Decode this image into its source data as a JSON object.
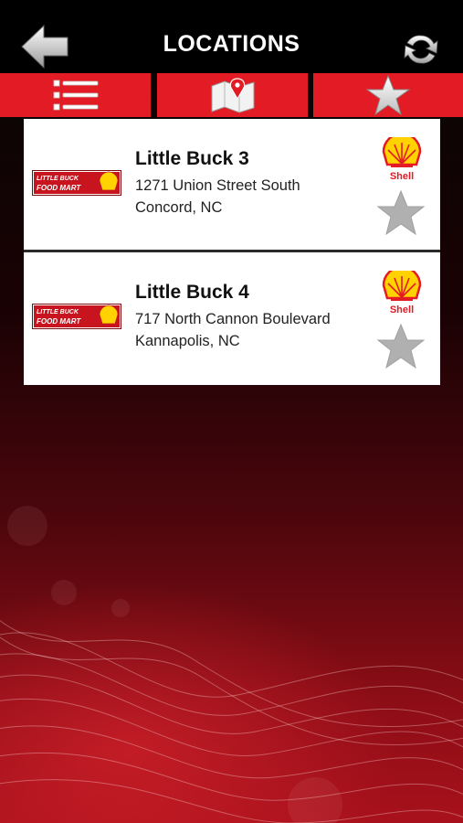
{
  "header": {
    "title": "LOCATIONS",
    "back_icon": "back-arrow-icon",
    "refresh_icon": "refresh-icon"
  },
  "tabs": [
    {
      "icon": "list-icon"
    },
    {
      "icon": "map-icon"
    },
    {
      "icon": "star-icon"
    }
  ],
  "colors": {
    "accent_red": "#e21b24",
    "header_bg": "#000000",
    "card_bg": "#ffffff",
    "star_gray": "#b0b0b0",
    "shell_yellow": "#ffd200"
  },
  "locations": [
    {
      "name": "Little Buck 3",
      "address_line1": "1271 Union Street South",
      "address_line2": "Concord, NC",
      "brand_logo_text": "LITTLE BUCK FOOD MART",
      "fuel_brand": "Shell"
    },
    {
      "name": "Little Buck 4",
      "address_line1": "717 North Cannon Boulevard",
      "address_line2": "Kannapolis, NC",
      "brand_logo_text": "LITTLE BUCK FOOD MART",
      "fuel_brand": "Shell"
    }
  ]
}
